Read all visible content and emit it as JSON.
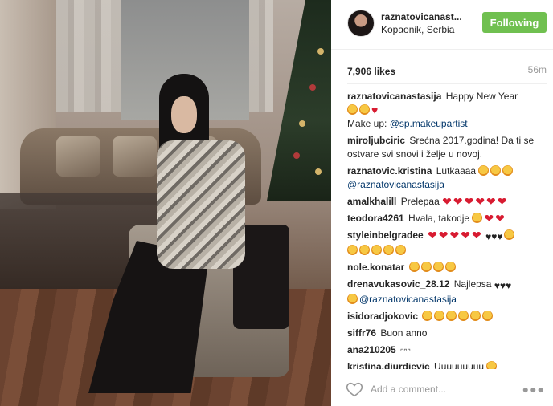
{
  "post_header": {
    "username": "raznatovicanastasija",
    "username_display": "raznatovicanast...",
    "location": "Kopaonik, Serbia",
    "follow_button_label": "Following",
    "follow_button_color": "#70c050"
  },
  "stats": {
    "likes": "7,906 likes",
    "time": "56m"
  },
  "comments": [
    {
      "user": "raznatovicanastasija",
      "text": "Happy New Year",
      "line2": "Make up:",
      "mention": "@sp.makeupartist"
    },
    {
      "user": "miroljubciric",
      "text": "Srećna 2017.godina! Da ti se ostvare svi snovi i želje u novoj."
    },
    {
      "user": "raznatovic.kristina",
      "text": "Lutkaaaa",
      "mention": "@raznatovicanastasija"
    },
    {
      "user": "amalkhalill",
      "text": "Prelepaa"
    },
    {
      "user": "teodora4261",
      "text": "Hvala, takodje"
    },
    {
      "user": "styleinbelgradee",
      "text": "♥♥♥"
    },
    {
      "user": "nole.konatar",
      "text": ""
    },
    {
      "user": "drenavukasovic_28.12",
      "text": "Najlepsa",
      "mention": "@raznatovicanastasija"
    },
    {
      "user": "isidoradjokovic",
      "text": ""
    },
    {
      "user": "siffr76",
      "text": "Buon anno"
    },
    {
      "user": "ana210205",
      "text": "▫▫▫"
    },
    {
      "user": "kristina.djurdjevic",
      "text": "Uuuuuuuuu"
    }
  ],
  "footer": {
    "comment_placeholder": "Add a comment...",
    "like_icon": "heart-outline-icon",
    "more_icon": "more-options-icon"
  }
}
